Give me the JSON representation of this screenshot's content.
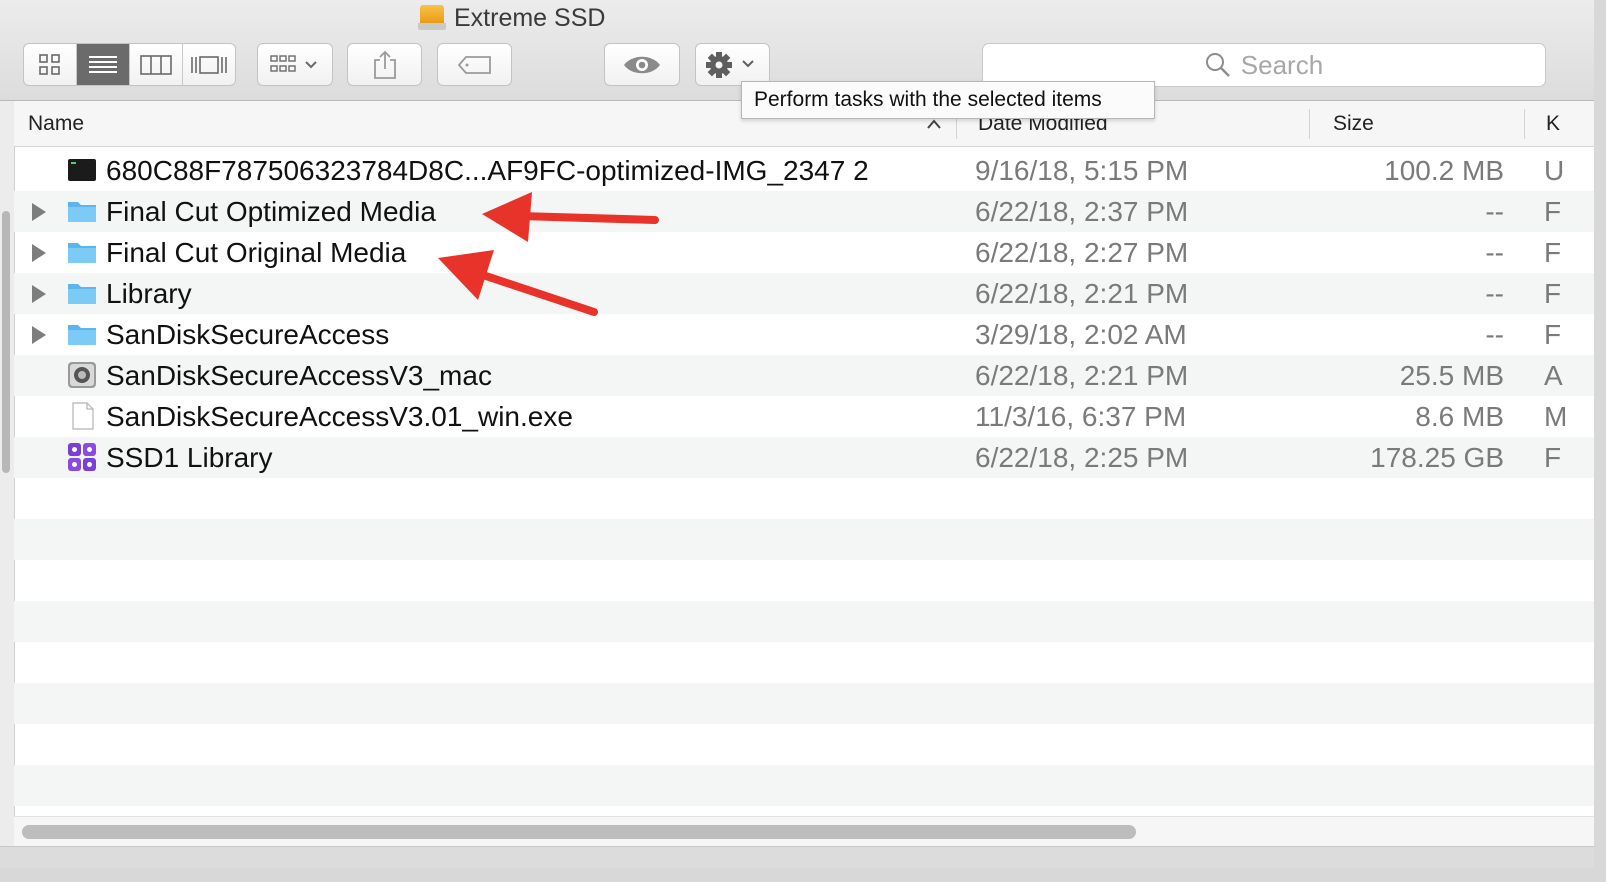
{
  "window": {
    "title": "Extreme SSD",
    "title_icon": "external-drive-icon"
  },
  "toolbar": {
    "view_buttons": [
      {
        "name": "icon-view",
        "icon": "grid-icon",
        "active": false
      },
      {
        "name": "list-view",
        "icon": "list-icon",
        "active": true
      },
      {
        "name": "column-view",
        "icon": "columns-icon",
        "active": false
      },
      {
        "name": "cover-flow-view",
        "icon": "cover-flow-icon",
        "active": false
      }
    ],
    "arrange_icon": "arrange-grid-icon",
    "share_icon": "share-icon",
    "tag_icon": "tag-icon",
    "quicklook_icon": "eye-icon",
    "action_icon": "gear-icon",
    "search": {
      "placeholder": "Search",
      "icon": "magnifier-icon"
    }
  },
  "tooltip": {
    "text": "Perform tasks with the selected items"
  },
  "columns": {
    "name": "Name",
    "date_modified": "Date Modified",
    "size": "Size",
    "kind": "K",
    "sort_indicator": "^"
  },
  "files": [
    {
      "name": "680C88F787506323784D8C...AF9FC-optimized-IMG_2347 2",
      "date": "9/16/18, 5:15 PM",
      "size": "100.2 MB",
      "kind": "U",
      "icon": "video-file-icon",
      "expandable": false
    },
    {
      "name": "Final Cut Optimized Media",
      "date": "6/22/18, 2:37 PM",
      "size": "--",
      "kind": "F",
      "icon": "folder-icon",
      "expandable": true
    },
    {
      "name": "Final Cut Original Media",
      "date": "6/22/18, 2:27 PM",
      "size": "--",
      "kind": "F",
      "icon": "folder-icon",
      "expandable": true
    },
    {
      "name": "Library",
      "date": "6/22/18, 2:21 PM",
      "size": "--",
      "kind": "F",
      "icon": "folder-icon",
      "expandable": true
    },
    {
      "name": "SanDiskSecureAccess",
      "date": "3/29/18, 2:02 AM",
      "size": "--",
      "kind": "F",
      "icon": "folder-icon",
      "expandable": true
    },
    {
      "name": "SanDiskSecureAccessV3_mac",
      "date": "6/22/18, 2:21 PM",
      "size": "25.5 MB",
      "kind": "A",
      "icon": "app-icon",
      "expandable": false
    },
    {
      "name": "SanDiskSecureAccessV3.01_win.exe",
      "date": "11/3/16, 6:37 PM",
      "size": "8.6 MB",
      "kind": "M",
      "icon": "document-icon",
      "expandable": false
    },
    {
      "name": "SSD1 Library",
      "date": "6/22/18, 2:25 PM",
      "size": "178.25 GB",
      "kind": "F",
      "icon": "fcp-library-icon",
      "expandable": false
    }
  ],
  "annotations": {
    "arrow_color": "#e8332a"
  }
}
